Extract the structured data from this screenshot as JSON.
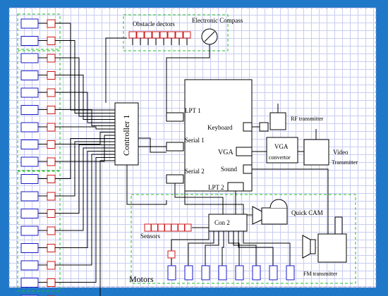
{
  "labels": {
    "obstacle": "Obstacle dectors",
    "compass": "Electronic Compass",
    "controller": "Controller 1",
    "lpt1": "LPT 1",
    "serial1": "Serial 1",
    "serial2": "Serial 2",
    "lpt2": "LPT 2",
    "keyboard": "Keyboard",
    "vga": "VGA",
    "sound": "Sound",
    "rf": "RF transmitter",
    "vga_conv1": "VGA",
    "vga_conv2": "convertor",
    "video1": "Video",
    "video2": "Transmitter",
    "quickcam": "Quick CAM",
    "con2": "Con 2",
    "sensors": "Sensors",
    "motors": "Motors",
    "fm": "FM transmitter"
  },
  "colors": {
    "background": "#1f78c8",
    "grid": "#c9cdf0",
    "blue_box": "#1818c8",
    "red_box": "#d01818",
    "green_dash": "#22c022",
    "wire": "#000000"
  }
}
